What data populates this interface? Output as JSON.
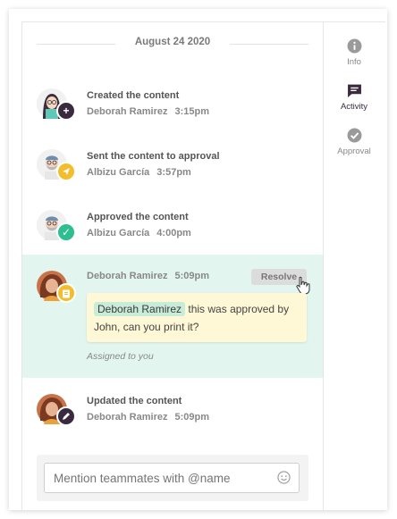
{
  "date_separator": "August 24 2020",
  "activities": [
    {
      "title": "Created the content",
      "author": "Deborah Ramirez",
      "time": "3:15pm",
      "badge": "plus-icon"
    },
    {
      "title": "Sent the content to approval",
      "author": "Albizu García",
      "time": "3:57pm",
      "badge": "send-icon"
    },
    {
      "title": "Approved the content",
      "author": "Albizu García",
      "time": "4:00pm",
      "badge": "check-icon"
    }
  ],
  "comment": {
    "author": "Deborah Ramirez",
    "time": "5:09pm",
    "resolve_label": "Resolve",
    "mention": "Deborah Ramirez",
    "text": " this was approved by John, can you print it?",
    "assigned": "Assigned to you",
    "badge": "clipboard-icon"
  },
  "update": {
    "title": "Updated the content",
    "author": "Deborah Ramirez",
    "time": "5:09pm",
    "badge": "pencil-icon"
  },
  "composer": {
    "placeholder": "Mention teammates with @name",
    "icon": "emoji-icon"
  },
  "side_nav": [
    {
      "label": "Info",
      "icon": "info-icon",
      "active": false
    },
    {
      "label": "Activity",
      "icon": "comment-icon",
      "active": true
    },
    {
      "label": "Approval",
      "icon": "check-circle-icon",
      "active": false
    }
  ],
  "colors": {
    "highlight_bg": "#e2f6ef",
    "comment_bg": "#fff8d6",
    "mention_bg": "#c9ecd9",
    "badge_dark": "#3b2a3f",
    "badge_yellow": "#f3be2e",
    "badge_green": "#2fbe8f",
    "rail_icon": "#9a9a9a",
    "rail_active": "#3b2a3f"
  }
}
